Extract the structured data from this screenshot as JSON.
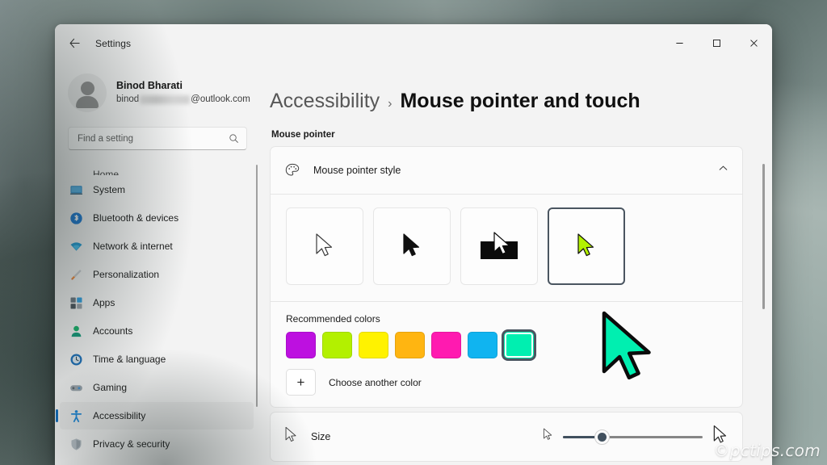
{
  "window": {
    "title": "Settings",
    "back_icon": "back-arrow-icon",
    "minimize_label": "—",
    "maximize_label": "☐",
    "close_label": "✕"
  },
  "account": {
    "name": "Binod Bharati",
    "email_prefix": "binod",
    "email_suffix": "@outlook.com"
  },
  "search": {
    "placeholder": "Find a setting",
    "icon": "search-icon"
  },
  "sidebar": {
    "items": [
      {
        "label": "Home",
        "icon": "home-icon",
        "selected": false,
        "partial": true
      },
      {
        "label": "System",
        "icon": "system-icon",
        "selected": false
      },
      {
        "label": "Bluetooth & devices",
        "icon": "bluetooth-icon",
        "selected": false
      },
      {
        "label": "Network & internet",
        "icon": "wifi-icon",
        "selected": false
      },
      {
        "label": "Personalization",
        "icon": "paintbrush-icon",
        "selected": false
      },
      {
        "label": "Apps",
        "icon": "apps-icon",
        "selected": false
      },
      {
        "label": "Accounts",
        "icon": "account-icon",
        "selected": false
      },
      {
        "label": "Time & language",
        "icon": "clock-icon",
        "selected": false
      },
      {
        "label": "Gaming",
        "icon": "gamepad-icon",
        "selected": false
      },
      {
        "label": "Accessibility",
        "icon": "accessibility-icon",
        "selected": true
      },
      {
        "label": "Privacy & security",
        "icon": "shield-icon",
        "selected": false
      }
    ]
  },
  "breadcrumb": {
    "parent": "Accessibility",
    "separator": "›",
    "current": "Mouse pointer and touch"
  },
  "main": {
    "section_label": "Mouse pointer",
    "pointer_style": {
      "title": "Mouse pointer style",
      "icon": "palette-icon",
      "expand_icon": "chevron-up-icon",
      "tiles": [
        {
          "name": "white",
          "selected": false
        },
        {
          "name": "black",
          "selected": false
        },
        {
          "name": "inverted",
          "selected": false
        },
        {
          "name": "custom",
          "selected": true
        }
      ]
    },
    "colors": {
      "title": "Recommended colors",
      "swatches": [
        {
          "hex": "#bd10e0",
          "selected": false
        },
        {
          "hex": "#b3f000",
          "selected": false
        },
        {
          "hex": "#fff200",
          "selected": false
        },
        {
          "hex": "#ffb511",
          "selected": false
        },
        {
          "hex": "#ff1ab0",
          "selected": false
        },
        {
          "hex": "#10b4f0",
          "selected": false
        },
        {
          "hex": "#00efb0",
          "selected": true
        }
      ],
      "choose_another": "Choose another color",
      "plus_icon": "plus-icon"
    },
    "preview_cursor_color": "#00efb0",
    "size": {
      "label": "Size",
      "icon": "cursor-icon",
      "small_icon": "small-cursor-icon",
      "large_icon": "large-cursor-icon",
      "value_percent": 28
    }
  },
  "watermark": "©pctips.com",
  "colors": {
    "accent": "#0f6cbd",
    "page_bg": "#f3f3f3",
    "card_bg": "#fbfbfb",
    "slider_fill": "#41505e"
  }
}
